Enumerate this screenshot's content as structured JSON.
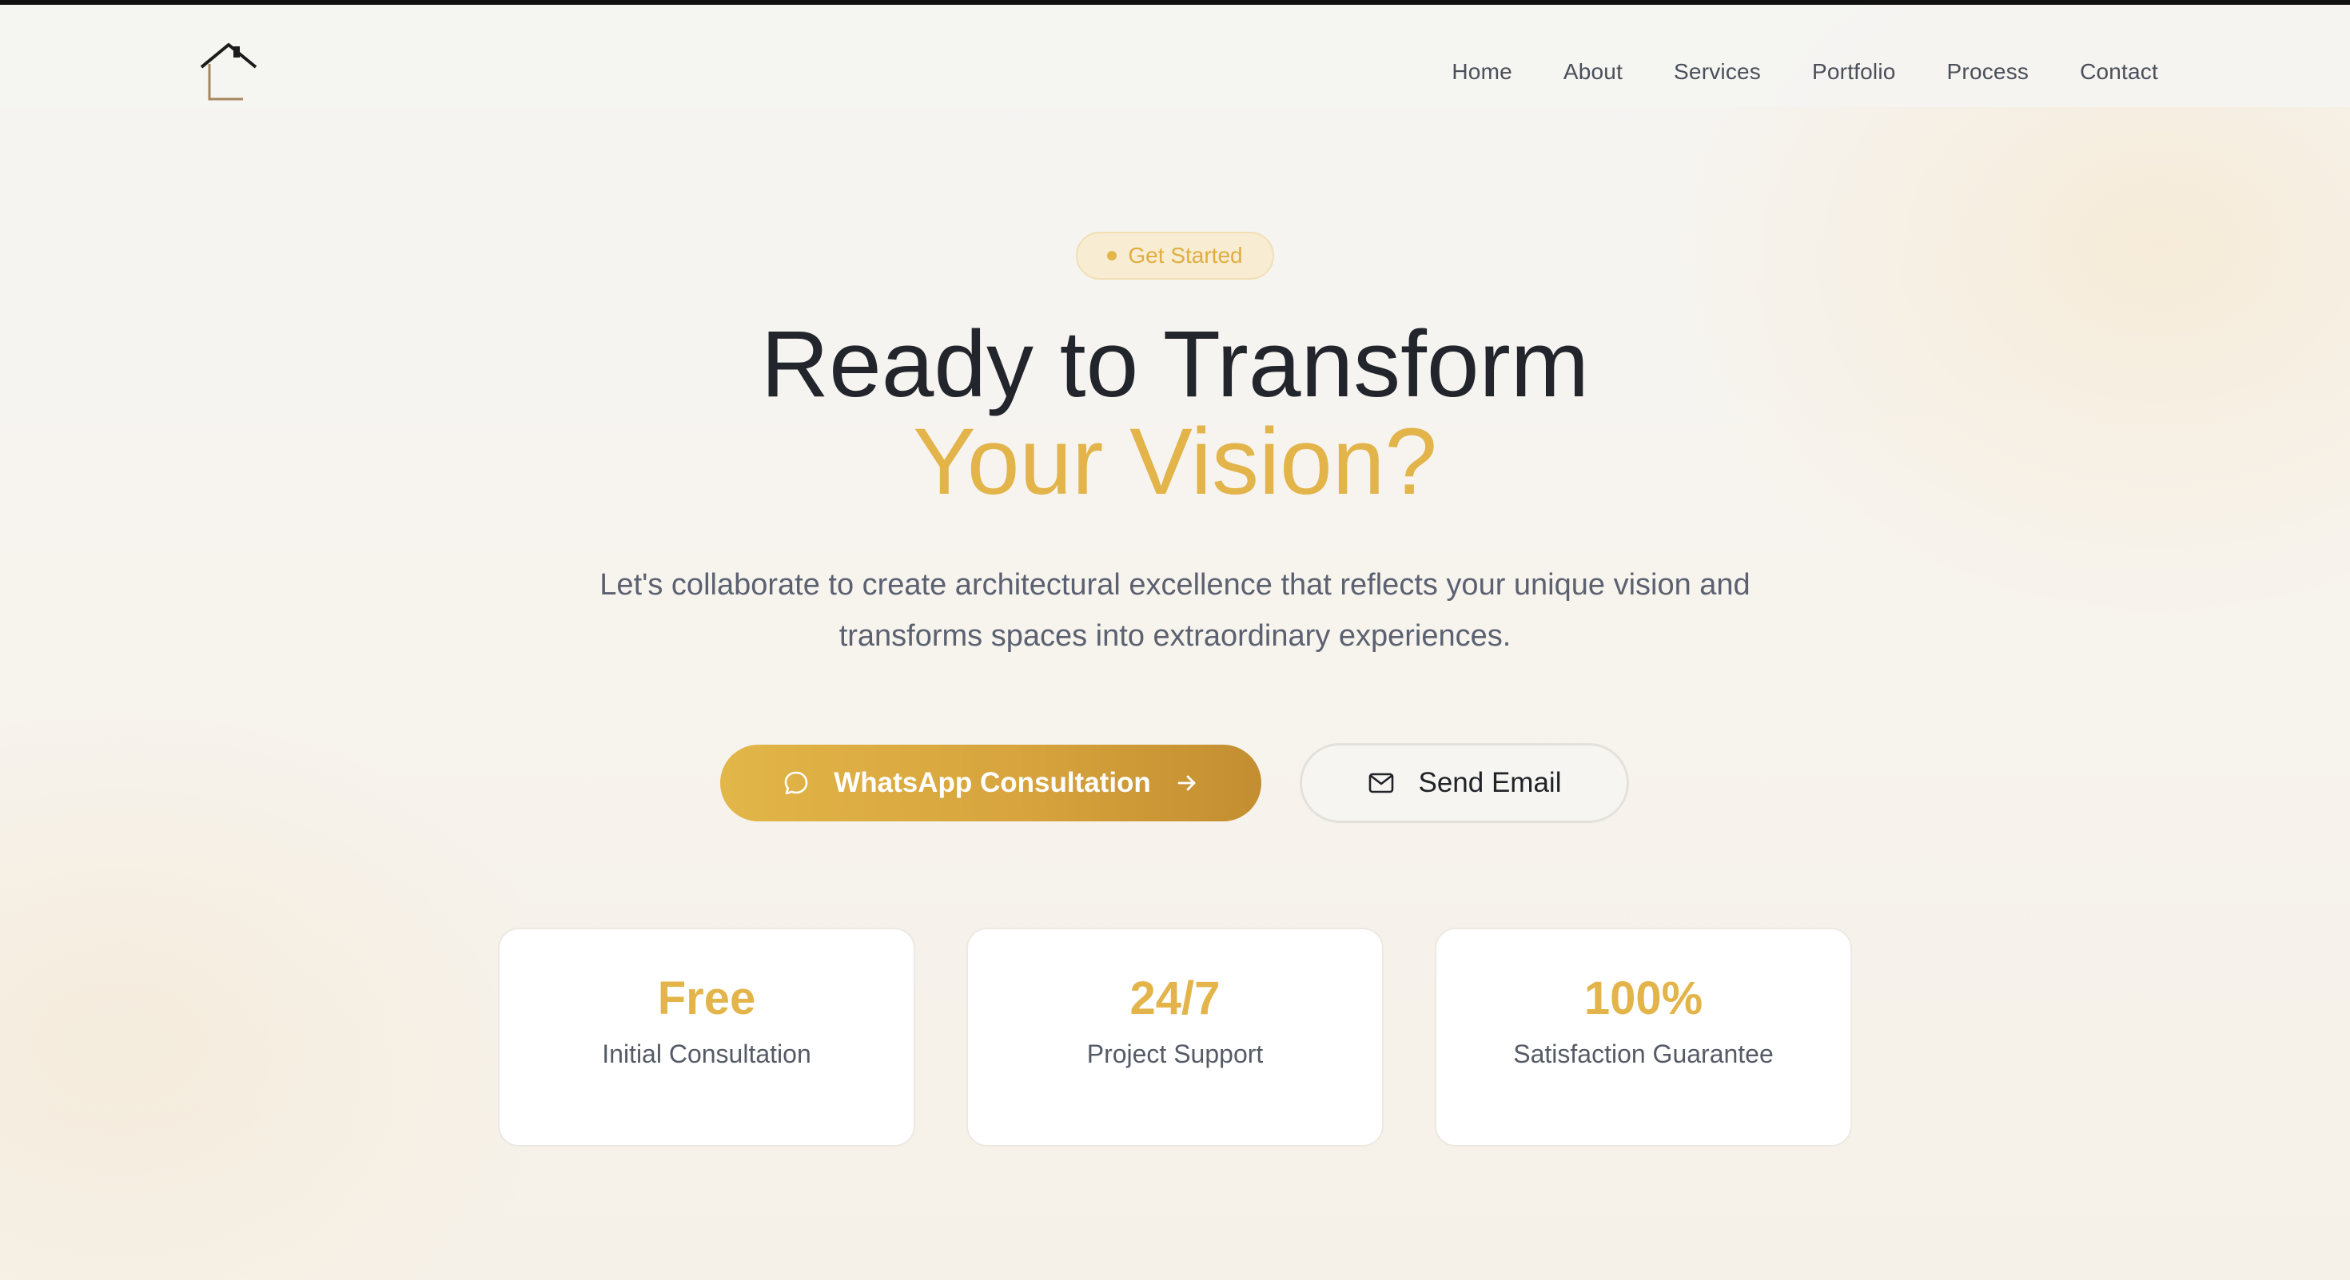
{
  "nav": {
    "items": [
      "Home",
      "About",
      "Services",
      "Portfolio",
      "Process",
      "Contact"
    ]
  },
  "hero": {
    "badge": "Get Started",
    "title_line1": "Ready to Transform",
    "title_line2": "Your Vision?",
    "subtitle": "Let's collaborate to create architectural excellence that reflects your unique vision and transforms spaces into extraordinary experiences."
  },
  "actions": {
    "whatsapp_label": "WhatsApp Consultation",
    "email_label": "Send Email"
  },
  "stats": [
    {
      "value": "Free",
      "label": "Initial Consultation"
    },
    {
      "value": "24/7",
      "label": "Project Support"
    },
    {
      "value": "100%",
      "label": "Satisfaction Guarantee"
    }
  ],
  "colors": {
    "accent": "#e2b44a",
    "text_dark": "#22252b",
    "text_muted": "#5b6170"
  },
  "icons": {
    "logo": "house-icon",
    "whatsapp": "chat-bubble-icon",
    "arrow": "arrow-right-icon",
    "email": "mail-icon"
  }
}
